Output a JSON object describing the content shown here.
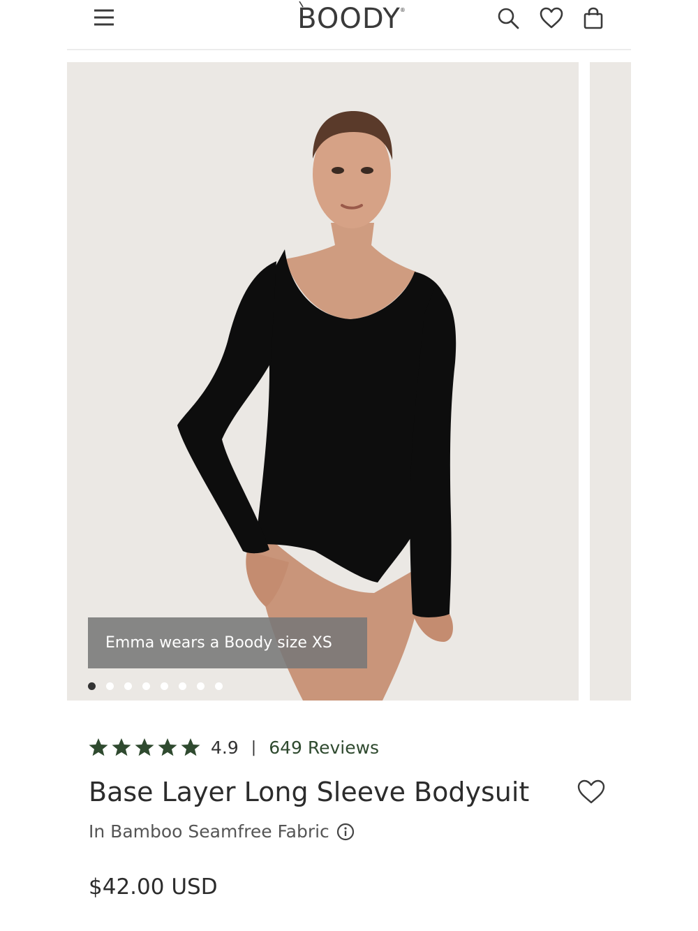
{
  "header": {
    "brand": "BOODY",
    "brand_mark": "®",
    "icons": [
      "menu-icon",
      "search-icon",
      "heart-icon",
      "bag-icon"
    ]
  },
  "gallery": {
    "caption": "Emma wears a Boody size XS",
    "slide_count": 8,
    "active_slide": 1,
    "background_color": "#ebe8e4",
    "garment_color": "#0d0d0d"
  },
  "product": {
    "rating_value": "4.9",
    "rating_separator": "|",
    "stars_filled": 5,
    "star_color": "#2f4a2f",
    "reviews_label": "649 Reviews",
    "title": "Base Layer Long Sleeve Bodysuit",
    "subtitle": "In Bamboo Seamfree Fabric",
    "price": "$42.00 USD"
  }
}
